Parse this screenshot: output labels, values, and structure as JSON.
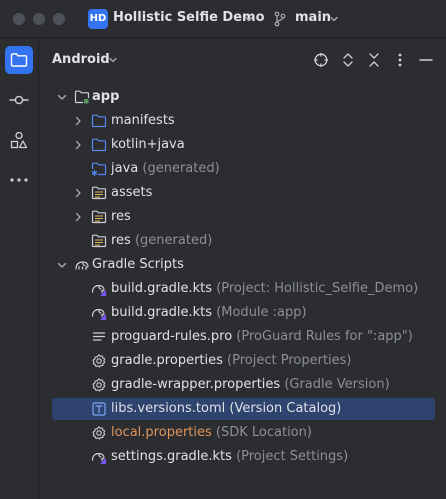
{
  "titlebar": {
    "project_badge": "HD",
    "project_name": "Hollistic Selfie Demo",
    "branch": "main"
  },
  "toolstrip": {
    "items": [
      "project-folder",
      "commit",
      "structure",
      "more"
    ]
  },
  "panel": {
    "title": "Android"
  },
  "tree": {
    "app": "app",
    "manifests": "manifests",
    "kotlin_java": "kotlin+java",
    "java": "java",
    "java_hint": " (generated)",
    "assets": "assets",
    "res": "res",
    "res_gen": "res",
    "res_gen_hint": " (generated)",
    "gradle_scripts": "Gradle Scripts",
    "build_project": "build.gradle.kts",
    "build_project_hint": " (Project: Hollistic_Selfie_Demo)",
    "build_module": "build.gradle.kts",
    "build_module_hint": " (Module :app)",
    "proguard": "proguard-rules.pro",
    "proguard_hint": " (ProGuard Rules for \":app\")",
    "gradle_props": "gradle.properties",
    "gradle_props_hint": " (Project Properties)",
    "wrapper_props": "gradle-wrapper.properties",
    "wrapper_props_hint": " (Gradle Version)",
    "libs_toml": "libs.versions.toml",
    "libs_toml_hint": " (Version Catalog)",
    "local_props": "local.properties",
    "local_props_hint": " (SDK Location)",
    "settings": "settings.gradle.kts",
    "settings_hint": " (Project Settings)"
  },
  "colors": {
    "background": "#2B2D30",
    "accent": "#3574F0",
    "selection": "#2E436E",
    "folder_blue": "#548AF7",
    "hint_gray": "#8C8F94",
    "modified_orange": "#E0945A"
  }
}
